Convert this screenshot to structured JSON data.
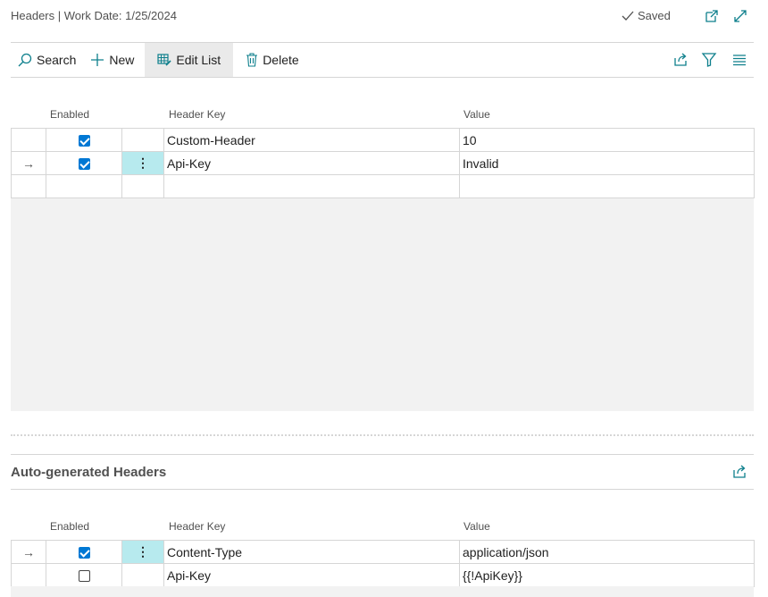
{
  "header": {
    "title": "Headers | Work Date: 1/25/2024",
    "saved_label": "Saved"
  },
  "toolbar": {
    "search_label": "Search",
    "new_label": "New",
    "edit_list_label": "Edit List",
    "delete_label": "Delete"
  },
  "grid1": {
    "columns": {
      "enabled": "Enabled",
      "key": "Header Key",
      "value": "Value"
    },
    "rows": [
      {
        "enabled": true,
        "key": "Custom-Header",
        "value": "10",
        "current": false
      },
      {
        "enabled": true,
        "key": "Api-Key",
        "value": "Invalid",
        "current": true
      }
    ]
  },
  "section2": {
    "title": "Auto-generated Headers",
    "columns": {
      "enabled": "Enabled",
      "key": "Header Key",
      "value": "Value"
    },
    "rows": [
      {
        "enabled": true,
        "key": "Content-Type",
        "value": "application/json",
        "current": true
      },
      {
        "enabled": false,
        "key": "Api-Key",
        "value": "{{!ApiKey}}",
        "current": false
      }
    ]
  },
  "glyphs": {
    "arrow": "→",
    "dots": "⋮"
  },
  "colors": {
    "accent": "#0d7f8c",
    "checkbox": "#0078d4",
    "selected_cell": "#b7eaee"
  }
}
